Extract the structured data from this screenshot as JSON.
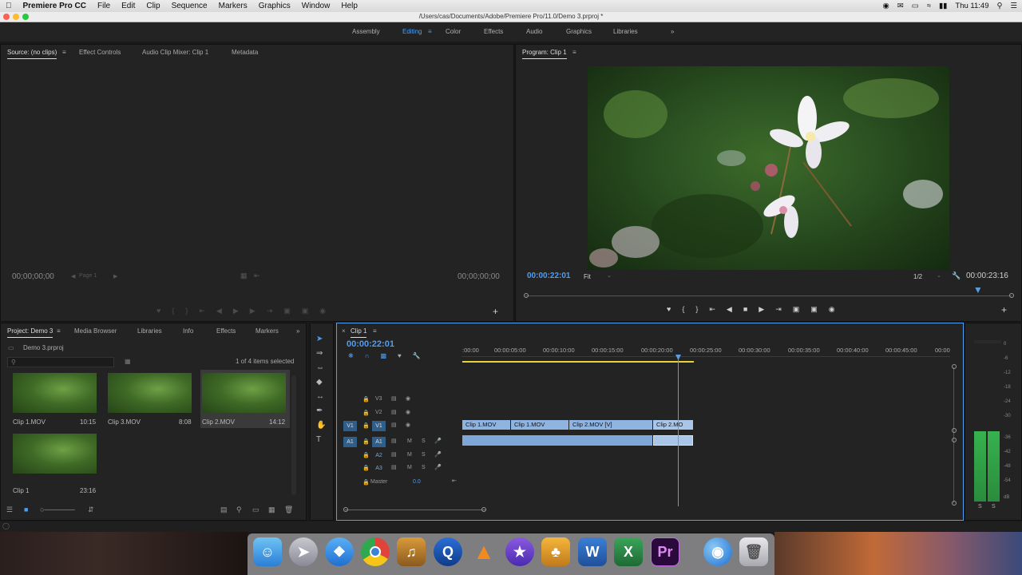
{
  "menubar": {
    "app_name": "Premiere Pro CC",
    "items": [
      "File",
      "Edit",
      "Clip",
      "Sequence",
      "Markers",
      "Graphics",
      "Window",
      "Help"
    ],
    "clock": "Thu 11:49"
  },
  "window": {
    "title": "/Users/cas/Documents/Adobe/Premiere Pro/11.0/Demo 3.prproj *"
  },
  "workspaces": [
    "Assembly",
    "Editing",
    "Color",
    "Effects",
    "Audio",
    "Graphics",
    "Libraries"
  ],
  "source_panel": {
    "tabs": [
      "Source: (no clips)",
      "Effect Controls",
      "Audio Clip Mixer: Clip 1",
      "Metadata"
    ],
    "timecode_in": "00;00;00;00",
    "timecode_out": "00;00;00;00",
    "page_label": "Page 1"
  },
  "program_panel": {
    "title": "Program: Clip 1",
    "timecode": "00:00:22:01",
    "fit": "Fit",
    "resolution": "1/2",
    "duration": "00:00:23:16",
    "playhead_fraction": 0.93
  },
  "project_panel": {
    "tabs": [
      "Project: Demo 3",
      "Media Browser",
      "Libraries",
      "Info",
      "Effects",
      "Markers"
    ],
    "project_file": "Demo 3.prproj",
    "selection_info": "1 of 4 items selected",
    "items": [
      {
        "name": "Clip 1.MOV",
        "duration": "10:15"
      },
      {
        "name": "Clip 3.MOV",
        "duration": "8:08"
      },
      {
        "name": "Clip 2.MOV",
        "duration": "14:12"
      },
      {
        "name": "Clip 1",
        "duration": "23:16"
      }
    ]
  },
  "timeline": {
    "tab": "Clip 1",
    "timecode": "00:00:22:01",
    "ruler": [
      ":00:00",
      "00:00:05:00",
      "00:00:10:00",
      "00:00:15:00",
      "00:00:20:00",
      "00:00:25:00",
      "00:00:30:00",
      "00:00:35:00",
      "00:00:40:00",
      "00:00:45:00",
      "00:00"
    ],
    "video_tracks": [
      "V3",
      "V2",
      "V1"
    ],
    "audio_tracks": [
      "A1",
      "A2",
      "A3"
    ],
    "source_patch_video": "V1",
    "source_patch_audio": "A1",
    "master_label": "Master",
    "master_value": "0.0",
    "clips_v1": [
      "Clip 1.MOV",
      "Clip 1.MOV",
      "Clip 2.MOV [V]",
      "Clip 2.MO"
    ],
    "track_buttons": {
      "mute": "M",
      "solo": "S"
    }
  },
  "audio_meter": {
    "scale": [
      "0",
      "-6",
      "-12",
      "-18",
      "-24",
      "-30",
      "-36",
      "-42",
      "-48",
      "-54",
      "dB"
    ],
    "channels": [
      "S",
      "S"
    ]
  },
  "colors": {
    "accent_blue": "#4d9ef5",
    "playhead_blue": "#5a9ee0",
    "clip_video": "#8fb4e0",
    "meter_green": "#3fc05a"
  }
}
